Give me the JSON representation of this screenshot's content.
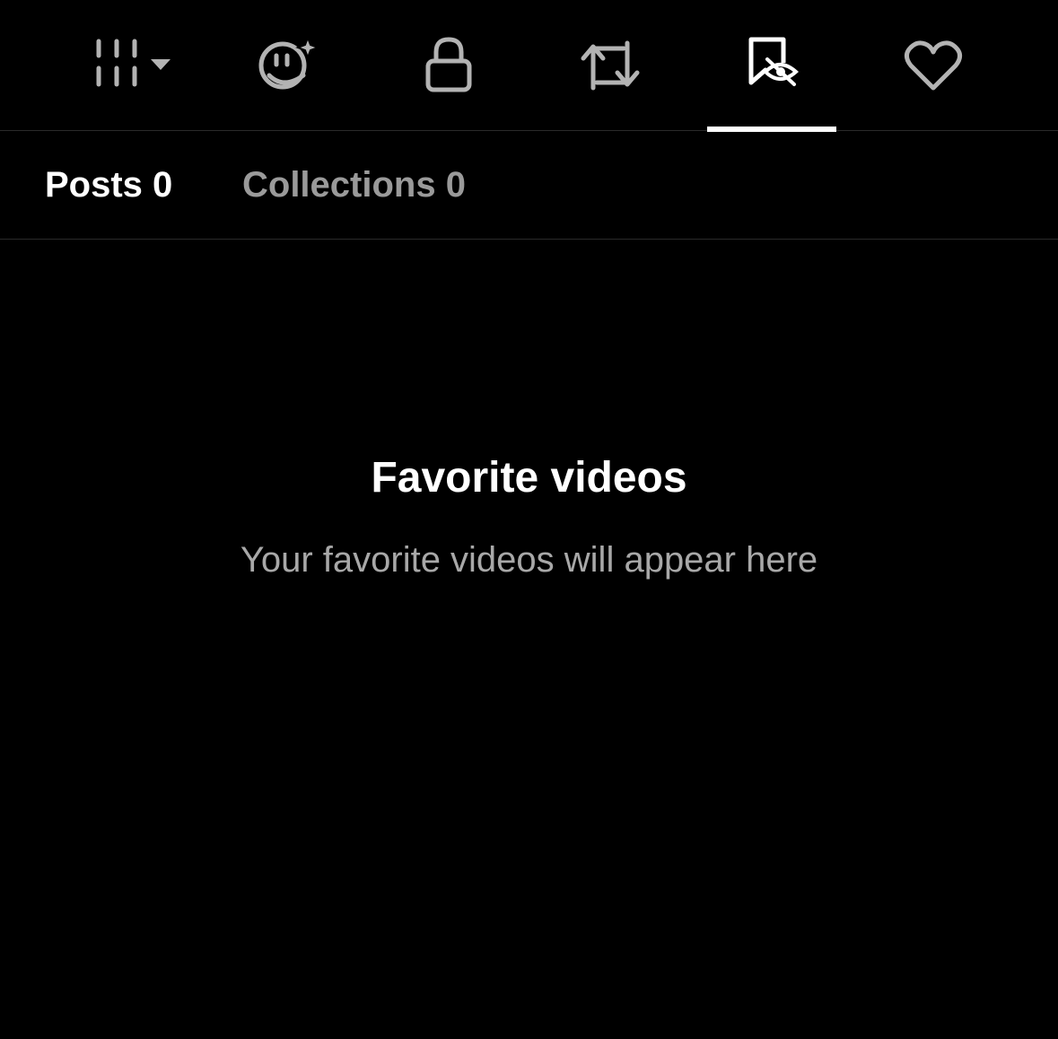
{
  "tabs": {
    "icons": [
      {
        "name": "grid-filter-icon"
      },
      {
        "name": "ai-face-sparkle-icon"
      },
      {
        "name": "lock-icon"
      },
      {
        "name": "repost-icon"
      },
      {
        "name": "favorites-hidden-icon",
        "active": true
      },
      {
        "name": "heart-icon"
      }
    ],
    "active_color": "#ffffff",
    "inactive_color": "#b3b3b3"
  },
  "sub_tabs": {
    "posts_label": "Posts 0",
    "collections_label": "Collections 0"
  },
  "empty_state": {
    "title": "Favorite videos",
    "subtitle": "Your favorite videos will appear here"
  }
}
